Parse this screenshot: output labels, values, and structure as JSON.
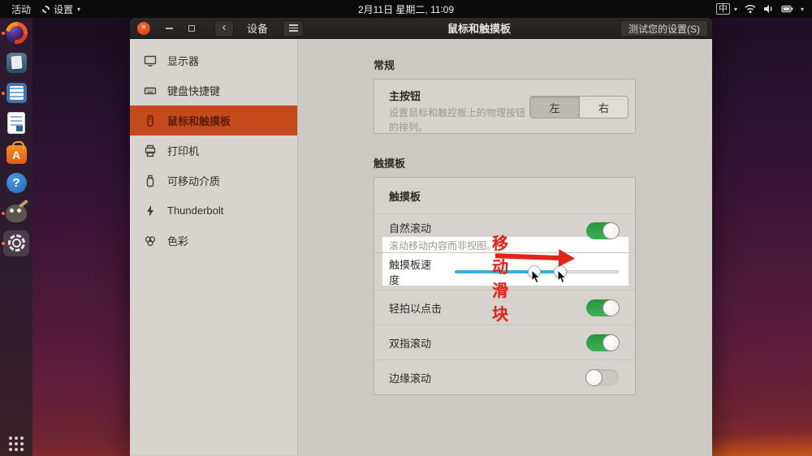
{
  "topbar": {
    "activities": "活动",
    "app_indicator": "设置",
    "clock": "2月11日 星期二, 11∶09",
    "input_method": "中"
  },
  "dock": {
    "items": [
      {
        "icon": "firefox",
        "running": true
      },
      {
        "icon": "files",
        "running": false
      },
      {
        "icon": "text-editor",
        "running": true
      },
      {
        "icon": "libreoffice-writer",
        "running": false
      },
      {
        "icon": "ubuntu-software",
        "running": false
      },
      {
        "icon": "help",
        "running": false
      },
      {
        "icon": "gimp",
        "running": true
      },
      {
        "icon": "settings",
        "running": true,
        "active": true
      }
    ],
    "software_letter": "A",
    "help_glyph": "?"
  },
  "window": {
    "titlebar": {
      "back_context": "设备",
      "title": "鼠标和触摸板",
      "test_button": "测试您的设置(S)",
      "close_glyph": "×"
    },
    "sidebar": {
      "items": [
        {
          "label": "显示器",
          "icon": "display"
        },
        {
          "label": "键盘快捷键",
          "icon": "keyboard"
        },
        {
          "label": "鼠标和触摸板",
          "icon": "mouse",
          "selected": true
        },
        {
          "label": "打印机",
          "icon": "printer"
        },
        {
          "label": "可移动介质",
          "icon": "removable-media"
        },
        {
          "label": "Thunderbolt",
          "icon": "thunderbolt"
        },
        {
          "label": "色彩",
          "icon": "color"
        }
      ]
    },
    "content": {
      "general": {
        "section_title": "常规",
        "primary_button": {
          "title": "主按钮",
          "subtitle": "设置鼠标和触控板上的物理按钮的排列。",
          "options": [
            "左",
            "右"
          ],
          "selected": "左"
        }
      },
      "touchpad": {
        "section_title": "触摸板",
        "header_row": "触摸板",
        "rows": [
          {
            "title": "自然滚动",
            "subtitle": "滚动移动内容而非视图。",
            "control": "toggle",
            "state": "on"
          },
          {
            "title": "触摸板速度",
            "control": "slider",
            "fill_percent": 63,
            "handles_percent": [
              48.5,
              64.5
            ]
          },
          {
            "title": "轻拍以点击",
            "control": "toggle",
            "state": "on"
          },
          {
            "title": "双指滚动",
            "control": "toggle",
            "state": "on"
          },
          {
            "title": "边缘滚动",
            "control": "toggle",
            "state": "off"
          }
        ]
      }
    }
  },
  "annotation": {
    "text": "移动滑块"
  },
  "colors": {
    "selection_orange": "#c4491c",
    "toggle_on_green": "#2f9e41",
    "slider_blue": "#35aede",
    "annotation_red": "#e02419",
    "close_button_orange": "#d93c10"
  }
}
